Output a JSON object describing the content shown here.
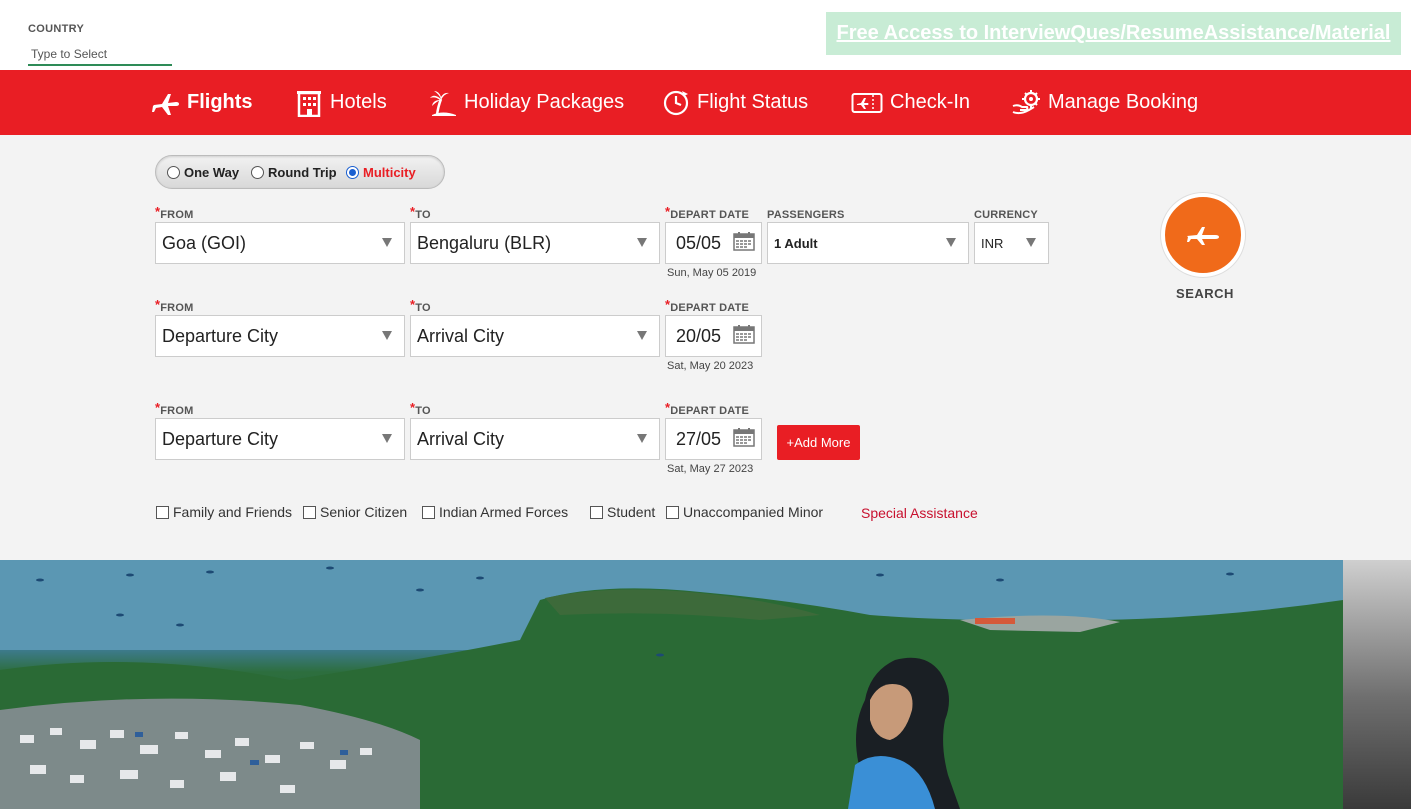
{
  "top": {
    "country_label": "COUNTRY",
    "country_placeholder": "Type to Select",
    "promo_text": "Free Access to InterviewQues/ResumeAssistance/Material"
  },
  "nav": {
    "items": [
      {
        "label": "Flights",
        "icon": "plane-icon",
        "active": true
      },
      {
        "label": "Hotels",
        "icon": "hotel-building-icon",
        "active": false
      },
      {
        "label": "Holiday Packages",
        "icon": "palm-tree-icon",
        "active": false
      },
      {
        "label": "Flight Status",
        "icon": "clock-plane-icon",
        "active": false
      },
      {
        "label": "Check-In",
        "icon": "ticket-icon",
        "active": false
      },
      {
        "label": "Manage Booking",
        "icon": "gear-hand-icon",
        "active": false
      }
    ]
  },
  "trip_types": {
    "options": [
      "One Way",
      "Round Trip",
      "Multicity"
    ],
    "selected": "Multicity"
  },
  "labels": {
    "from": "FROM",
    "to": "TO",
    "depart_date": "DEPART DATE",
    "passengers": "PASSENGERS",
    "currency": "CURRENCY",
    "required_mark": "*"
  },
  "legs": [
    {
      "from": "Goa (GOI)",
      "to": "Bengaluru (BLR)",
      "date": "05/05",
      "date_full": "Sun, May 05 2019"
    },
    {
      "from": "Departure City",
      "to": "Arrival City",
      "date": "20/05",
      "date_full": "Sat, May 20 2023"
    },
    {
      "from": "Departure City",
      "to": "Arrival City",
      "date": "27/05",
      "date_full": "Sat, May 27 2023"
    }
  ],
  "passengers": "1 Adult",
  "currency": "INR",
  "add_more_label": "+Add More",
  "search_label": "SEARCH",
  "discounts": [
    "Family and Friends",
    "Senior Citizen",
    "Indian Armed Forces",
    "Student",
    "Unaccompanied Minor"
  ],
  "special_assistance": "Special Assistance",
  "colors": {
    "brand_red": "#e91e24",
    "search_orange": "#f06a1a",
    "promo_bg": "#c8ecd5",
    "radio_blue": "#1a5fd0"
  }
}
